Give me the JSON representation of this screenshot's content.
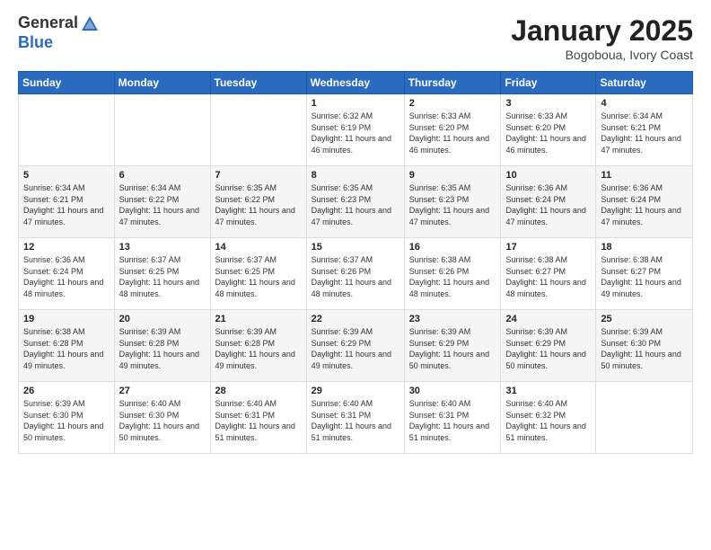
{
  "logo": {
    "general": "General",
    "blue": "Blue"
  },
  "title": "January 2025",
  "subtitle": "Bogoboua, Ivory Coast",
  "weekdays": [
    "Sunday",
    "Monday",
    "Tuesday",
    "Wednesday",
    "Thursday",
    "Friday",
    "Saturday"
  ],
  "weeks": [
    [
      {
        "num": "",
        "sunrise": "",
        "sunset": "",
        "daylight": ""
      },
      {
        "num": "",
        "sunrise": "",
        "sunset": "",
        "daylight": ""
      },
      {
        "num": "",
        "sunrise": "",
        "sunset": "",
        "daylight": ""
      },
      {
        "num": "1",
        "sunrise": "6:32 AM",
        "sunset": "6:19 PM",
        "daylight": "11 hours and 46 minutes."
      },
      {
        "num": "2",
        "sunrise": "6:33 AM",
        "sunset": "6:20 PM",
        "daylight": "11 hours and 46 minutes."
      },
      {
        "num": "3",
        "sunrise": "6:33 AM",
        "sunset": "6:20 PM",
        "daylight": "11 hours and 46 minutes."
      },
      {
        "num": "4",
        "sunrise": "6:34 AM",
        "sunset": "6:21 PM",
        "daylight": "11 hours and 47 minutes."
      }
    ],
    [
      {
        "num": "5",
        "sunrise": "6:34 AM",
        "sunset": "6:21 PM",
        "daylight": "11 hours and 47 minutes."
      },
      {
        "num": "6",
        "sunrise": "6:34 AM",
        "sunset": "6:22 PM",
        "daylight": "11 hours and 47 minutes."
      },
      {
        "num": "7",
        "sunrise": "6:35 AM",
        "sunset": "6:22 PM",
        "daylight": "11 hours and 47 minutes."
      },
      {
        "num": "8",
        "sunrise": "6:35 AM",
        "sunset": "6:23 PM",
        "daylight": "11 hours and 47 minutes."
      },
      {
        "num": "9",
        "sunrise": "6:35 AM",
        "sunset": "6:23 PM",
        "daylight": "11 hours and 47 minutes."
      },
      {
        "num": "10",
        "sunrise": "6:36 AM",
        "sunset": "6:24 PM",
        "daylight": "11 hours and 47 minutes."
      },
      {
        "num": "11",
        "sunrise": "6:36 AM",
        "sunset": "6:24 PM",
        "daylight": "11 hours and 47 minutes."
      }
    ],
    [
      {
        "num": "12",
        "sunrise": "6:36 AM",
        "sunset": "6:24 PM",
        "daylight": "11 hours and 48 minutes."
      },
      {
        "num": "13",
        "sunrise": "6:37 AM",
        "sunset": "6:25 PM",
        "daylight": "11 hours and 48 minutes."
      },
      {
        "num": "14",
        "sunrise": "6:37 AM",
        "sunset": "6:25 PM",
        "daylight": "11 hours and 48 minutes."
      },
      {
        "num": "15",
        "sunrise": "6:37 AM",
        "sunset": "6:26 PM",
        "daylight": "11 hours and 48 minutes."
      },
      {
        "num": "16",
        "sunrise": "6:38 AM",
        "sunset": "6:26 PM",
        "daylight": "11 hours and 48 minutes."
      },
      {
        "num": "17",
        "sunrise": "6:38 AM",
        "sunset": "6:27 PM",
        "daylight": "11 hours and 48 minutes."
      },
      {
        "num": "18",
        "sunrise": "6:38 AM",
        "sunset": "6:27 PM",
        "daylight": "11 hours and 49 minutes."
      }
    ],
    [
      {
        "num": "19",
        "sunrise": "6:38 AM",
        "sunset": "6:28 PM",
        "daylight": "11 hours and 49 minutes."
      },
      {
        "num": "20",
        "sunrise": "6:39 AM",
        "sunset": "6:28 PM",
        "daylight": "11 hours and 49 minutes."
      },
      {
        "num": "21",
        "sunrise": "6:39 AM",
        "sunset": "6:28 PM",
        "daylight": "11 hours and 49 minutes."
      },
      {
        "num": "22",
        "sunrise": "6:39 AM",
        "sunset": "6:29 PM",
        "daylight": "11 hours and 49 minutes."
      },
      {
        "num": "23",
        "sunrise": "6:39 AM",
        "sunset": "6:29 PM",
        "daylight": "11 hours and 50 minutes."
      },
      {
        "num": "24",
        "sunrise": "6:39 AM",
        "sunset": "6:29 PM",
        "daylight": "11 hours and 50 minutes."
      },
      {
        "num": "25",
        "sunrise": "6:39 AM",
        "sunset": "6:30 PM",
        "daylight": "11 hours and 50 minutes."
      }
    ],
    [
      {
        "num": "26",
        "sunrise": "6:39 AM",
        "sunset": "6:30 PM",
        "daylight": "11 hours and 50 minutes."
      },
      {
        "num": "27",
        "sunrise": "6:40 AM",
        "sunset": "6:30 PM",
        "daylight": "11 hours and 50 minutes."
      },
      {
        "num": "28",
        "sunrise": "6:40 AM",
        "sunset": "6:31 PM",
        "daylight": "11 hours and 51 minutes."
      },
      {
        "num": "29",
        "sunrise": "6:40 AM",
        "sunset": "6:31 PM",
        "daylight": "11 hours and 51 minutes."
      },
      {
        "num": "30",
        "sunrise": "6:40 AM",
        "sunset": "6:31 PM",
        "daylight": "11 hours and 51 minutes."
      },
      {
        "num": "31",
        "sunrise": "6:40 AM",
        "sunset": "6:32 PM",
        "daylight": "11 hours and 51 minutes."
      },
      {
        "num": "",
        "sunrise": "",
        "sunset": "",
        "daylight": ""
      }
    ]
  ],
  "labels": {
    "sunrise": "Sunrise:",
    "sunset": "Sunset:",
    "daylight": "Daylight:"
  }
}
